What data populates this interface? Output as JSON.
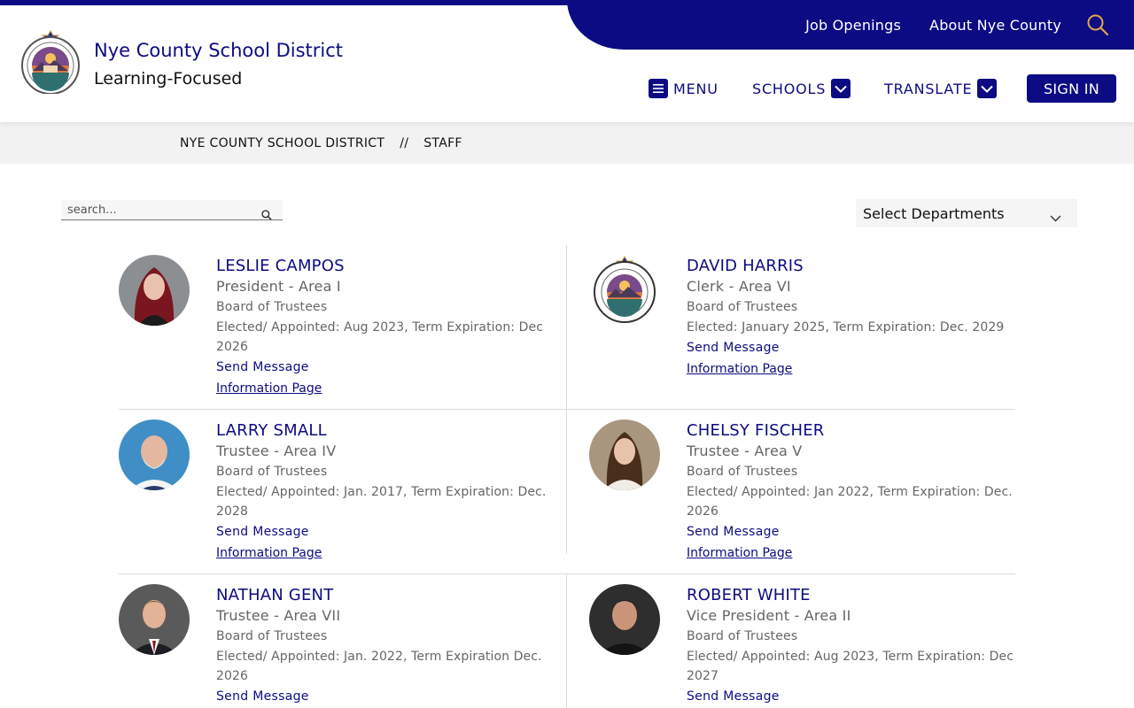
{
  "header": {
    "site_name": "Nye County School District",
    "tagline": "Learning-Focused",
    "top_links": [
      "Job Openings",
      "About Nye County"
    ],
    "nav": {
      "menu": "MENU",
      "schools": "SCHOOLS",
      "translate": "TRANSLATE",
      "sign_in": "SIGN IN"
    },
    "accent_color": "#0c0b83"
  },
  "breadcrumb": {
    "items": [
      "NYE COUNTY SCHOOL DISTRICT",
      "STAFF"
    ],
    "separator": "//"
  },
  "filters": {
    "search_placeholder": "search...",
    "department_select": "Select Departments"
  },
  "staff": [
    {
      "name": "LESLIE CAMPOS",
      "title": "President - Area I",
      "department": "Board of Trustees",
      "elected": "Elected/ Appointed: Aug 2023, Term Expiration: Dec 2026",
      "send_message": "Send Message",
      "info_page": "Information Page"
    },
    {
      "name": "DAVID HARRIS",
      "title": "Clerk - Area VI",
      "department": "Board of Trustees",
      "elected": "Elected: January 2025, Term Expiration: Dec. 2029",
      "send_message": "Send Message",
      "info_page": "Information Page"
    },
    {
      "name": "LARRY SMALL",
      "title": "Trustee - Area IV",
      "department": "Board of Trustees",
      "elected": "Elected/ Appointed: Jan. 2017, Term Expiration: Dec. 2028",
      "send_message": "Send Message",
      "info_page": "Information Page"
    },
    {
      "name": "CHELSY FISCHER",
      "title": "Trustee - Area V",
      "department": "Board of Trustees",
      "elected": "Elected/ Appointed: Jan 2022, Term Expiration: Dec. 2026",
      "send_message": "Send Message",
      "info_page": "Information Page"
    },
    {
      "name": "NATHAN GENT",
      "title": "Trustee - Area VII",
      "department": "Board of Trustees",
      "elected": "Elected/ Appointed: Jan. 2022, Term Expiration Dec. 2026",
      "send_message": "Send Message"
    },
    {
      "name": "ROBERT WHITE",
      "title": "Vice President - Area II",
      "department": "Board of Trustees",
      "elected": "Elected/ Appointed: Aug 2023, Term Expiration: Dec 2027",
      "send_message": "Send Message"
    }
  ]
}
